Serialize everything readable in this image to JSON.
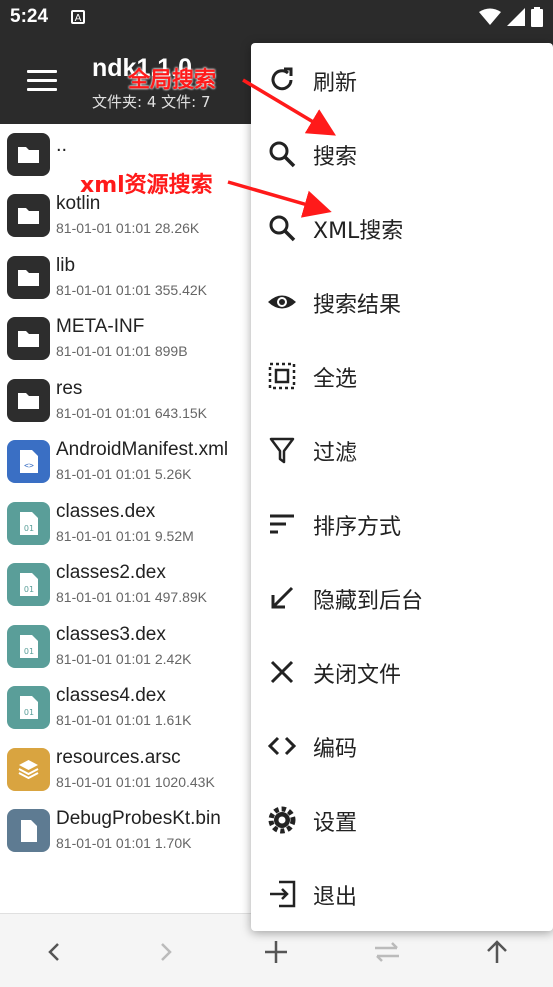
{
  "status": {
    "time": "5:24",
    "notif_glyph": "A"
  },
  "appbar": {
    "title": "ndk1.1.0",
    "subtitle": "文件夹: 4  文件: 7"
  },
  "files": [
    {
      "name": "..",
      "meta": "",
      "kind": "folder"
    },
    {
      "name": "kotlin",
      "meta": "81-01-01 01:01  28.26K",
      "kind": "folder"
    },
    {
      "name": "lib",
      "meta": "81-01-01 01:01  355.42K",
      "kind": "folder"
    },
    {
      "name": "META-INF",
      "meta": "81-01-01 01:01  899B",
      "kind": "folder"
    },
    {
      "name": "res",
      "meta": "81-01-01 01:01  643.15K",
      "kind": "folder"
    },
    {
      "name": "AndroidManifest.xml",
      "meta": "81-01-01 01:01  5.26K",
      "kind": "xml"
    },
    {
      "name": "classes.dex",
      "meta": "81-01-01 01:01  9.52M",
      "kind": "dex"
    },
    {
      "name": "classes2.dex",
      "meta": "81-01-01 01:01  497.89K",
      "kind": "dex"
    },
    {
      "name": "classes3.dex",
      "meta": "81-01-01 01:01  2.42K",
      "kind": "dex"
    },
    {
      "name": "classes4.dex",
      "meta": "81-01-01 01:01  1.61K",
      "kind": "dex"
    },
    {
      "name": "resources.arsc",
      "meta": "81-01-01 01:01  1020.43K",
      "kind": "arsc"
    },
    {
      "name": "DebugProbesKt.bin",
      "meta": "81-01-01 01:01  1.70K",
      "kind": "bin"
    }
  ],
  "menu": [
    {
      "label": "刷新",
      "icon": "refresh-icon"
    },
    {
      "label": "搜索",
      "icon": "search-icon"
    },
    {
      "label": "XML搜索",
      "icon": "search-icon"
    },
    {
      "label": "搜索结果",
      "icon": "eye-icon"
    },
    {
      "label": "全选",
      "icon": "select-all-icon"
    },
    {
      "label": "过滤",
      "icon": "filter-icon"
    },
    {
      "label": "排序方式",
      "icon": "sort-icon"
    },
    {
      "label": "隐藏到后台",
      "icon": "arrow-down-left-icon"
    },
    {
      "label": "关闭文件",
      "icon": "close-icon"
    },
    {
      "label": "编码",
      "icon": "code-icon"
    },
    {
      "label": "设置",
      "icon": "gear-icon"
    },
    {
      "label": "退出",
      "icon": "exit-icon"
    }
  ],
  "annotations": {
    "global_search": "全局搜索",
    "xml_search": "xml资源搜索"
  },
  "colors": {
    "appbar": "#2b2b2b",
    "folder_icon": "#2d2d2d",
    "xml_icon": "#3a6fc4",
    "dex_icon": "#5a9e99",
    "arsc_icon": "#d9a440",
    "bin_icon": "#5e7b92",
    "annotation": "#ff1a1a"
  },
  "bottombar": {
    "icons": [
      "back-icon",
      "forward-icon",
      "add-icon",
      "swap-icon",
      "up-icon"
    ]
  }
}
